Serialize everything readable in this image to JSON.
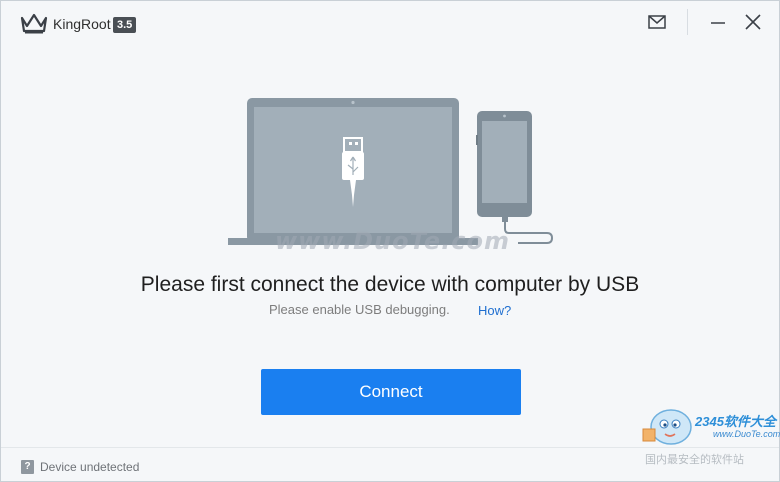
{
  "app": {
    "title": "KingRoot",
    "version": "3.5"
  },
  "titlebar": {
    "icons": [
      "crown-logo-icon",
      "mail-icon",
      "minimize-icon",
      "close-icon"
    ]
  },
  "main": {
    "headline": "Please first connect the device with computer by USB",
    "subtext": "Please enable USB debugging.",
    "help_link": "How?",
    "connect_button": "Connect"
  },
  "status": {
    "icon": "?",
    "text": "Device undetected"
  },
  "watermarks": {
    "center": "www.DuoTe.com",
    "brand": "2345软件大全",
    "url": "www.DuoTe.com",
    "tagline": "国内最安全的软件站"
  },
  "colors": {
    "accent": "#1a7ff0",
    "link": "#1f6fd0",
    "illustration": "#8a98a3"
  }
}
